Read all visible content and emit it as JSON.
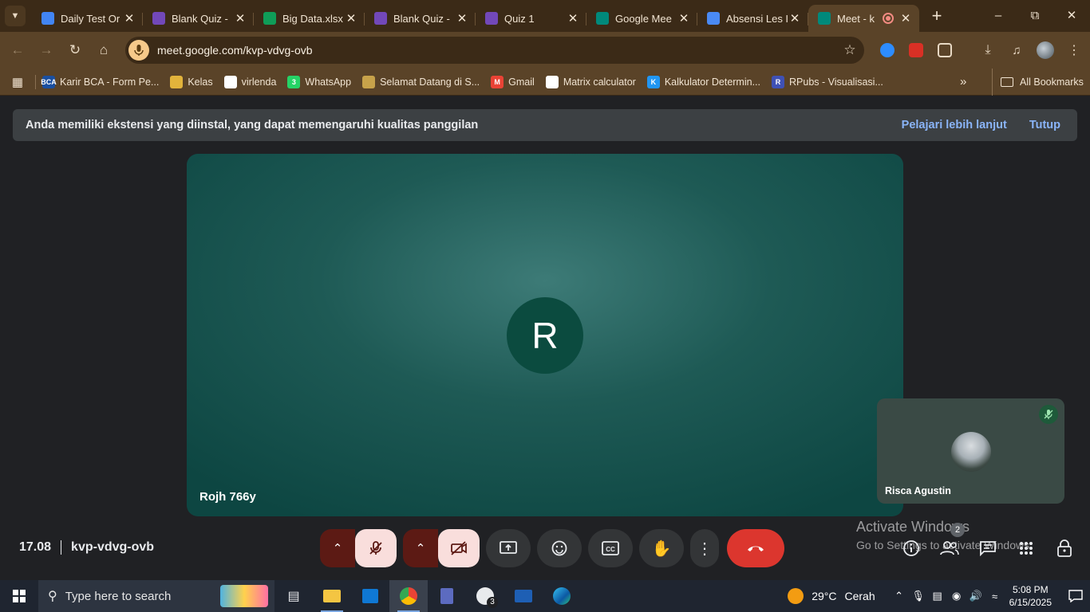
{
  "browser": {
    "tabs": [
      {
        "title": "Daily Test Or",
        "color": "#4285f4"
      },
      {
        "title": "Blank Quiz -",
        "color": "#7248b9"
      },
      {
        "title": "Big Data.xlsx",
        "color": "#0f9d58"
      },
      {
        "title": "Blank Quiz -",
        "color": "#7248b9"
      },
      {
        "title": "Quiz 1",
        "color": "#7248b9"
      },
      {
        "title": "Google Mee",
        "color": "#00897b"
      },
      {
        "title": "Absensi Les I",
        "color": "#4a8af4"
      },
      {
        "title": "Meet - k",
        "color": "#00897b"
      }
    ],
    "url": "meet.google.com/kvp-vdvg-ovb",
    "bookmarks": [
      {
        "label": "Karir BCA - Form Pe...",
        "color": "#1a4fa0",
        "glyph": "BCA"
      },
      {
        "label": "Kelas",
        "color": "#e2b33b",
        "glyph": ""
      },
      {
        "label": "virlenda",
        "color": "#ffffff",
        "glyph": ""
      },
      {
        "label": "WhatsApp",
        "color": "#25d366",
        "glyph": "3"
      },
      {
        "label": "Selamat Datang di S...",
        "color": "#c7a24a",
        "glyph": ""
      },
      {
        "label": "Gmail",
        "color": "#ea4335",
        "glyph": "M"
      },
      {
        "label": "Matrix calculator",
        "color": "#ffffff",
        "glyph": ""
      },
      {
        "label": "Kalkulator Determin...",
        "color": "#2196f3",
        "glyph": "K"
      },
      {
        "label": "RPubs - Visualisasi...",
        "color": "#3f51b5",
        "glyph": "R"
      }
    ],
    "all_bookmarks": "All Bookmarks"
  },
  "meet": {
    "banner": {
      "text": "Anda memiliki ekstensi yang diinstal, yang dapat memengaruhi kualitas panggilan",
      "learn_more": "Pelajari lebih lanjut",
      "close": "Tutup"
    },
    "main_participant": {
      "initial": "R",
      "name": "Rojh 766y"
    },
    "self_participant": {
      "name": "Risca Agustin"
    },
    "time": "17.08",
    "meeting_code": "kvp-vdvg-ovb",
    "participant_count": "2"
  },
  "watermark": {
    "line1": "Activate Windows",
    "line2": "Go to Settings to activate Windows."
  },
  "taskbar": {
    "search_placeholder": "Type here to search",
    "chrome_badge": "3",
    "temperature": "29°C",
    "weather": "Cerah",
    "time": "5:08 PM",
    "date": "6/15/2025"
  }
}
